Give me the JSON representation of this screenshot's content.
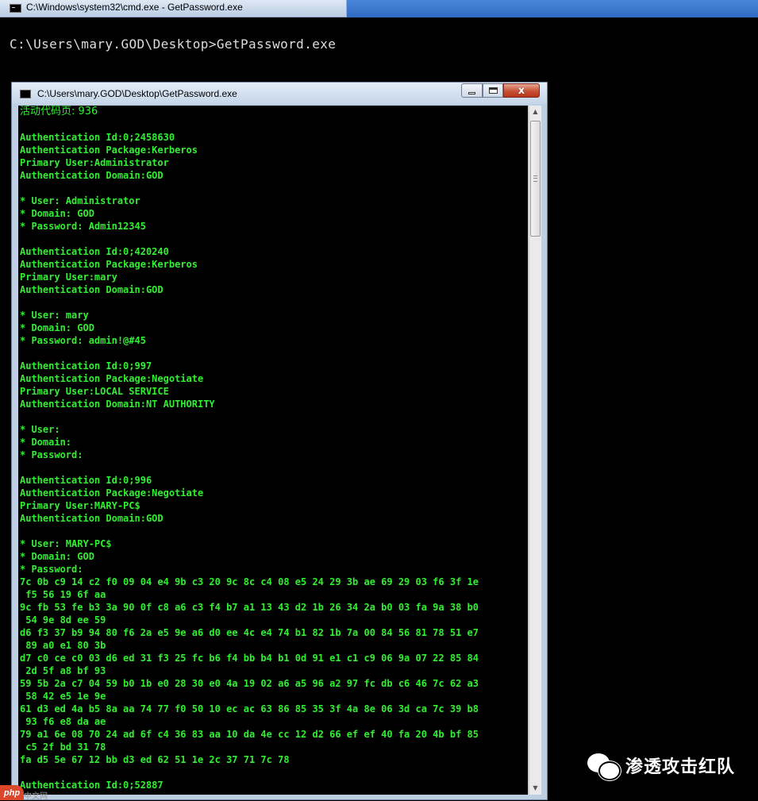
{
  "outer_window": {
    "title": "C:\\Windows\\system32\\cmd.exe - GetPassword.exe",
    "prompt_line": "C:\\Users\\mary.GOD\\Desktop>GetPassword.exe"
  },
  "inner_window": {
    "title": "C:\\Users\\mary.GOD\\Desktop\\GetPassword.exe",
    "close_glyph": "x",
    "console_lines": [
      "活动代码页: 936",
      "",
      "Authentication Id:0;2458630",
      "Authentication Package:Kerberos",
      "Primary User:Administrator",
      "Authentication Domain:GOD",
      "",
      "* User: Administrator",
      "* Domain: GOD",
      "* Password: Admin12345",
      "",
      "Authentication Id:0;420240",
      "Authentication Package:Kerberos",
      "Primary User:mary",
      "Authentication Domain:GOD",
      "",
      "* User: mary",
      "* Domain: GOD",
      "* Password: admin!@#45",
      "",
      "Authentication Id:0;997",
      "Authentication Package:Negotiate",
      "Primary User:LOCAL SERVICE",
      "Authentication Domain:NT AUTHORITY",
      "",
      "* User:",
      "* Domain:",
      "* Password:",
      "",
      "Authentication Id:0;996",
      "Authentication Package:Negotiate",
      "Primary User:MARY-PC$",
      "Authentication Domain:GOD",
      "",
      "* User: MARY-PC$",
      "* Domain: GOD",
      "* Password:",
      "7c 0b c9 14 c2 f0 09 04 e4 9b c3 20 9c 8c c4 08 e5 24 29 3b ae 69 29 03 f6 3f 1e",
      " f5 56 19 6f aa",
      "9c fb 53 fe b3 3a 90 0f c8 a6 c3 f4 b7 a1 13 43 d2 1b 26 34 2a b0 03 fa 9a 38 b0",
      " 54 9e 8d ee 59",
      "d6 f3 37 b9 94 80 f6 2a e5 9e a6 d0 ee 4c e4 74 b1 82 1b 7a 00 84 56 81 78 51 e7",
      " 89 a0 e1 80 3b",
      "d7 c0 ce c0 03 d6 ed 31 f3 25 fc b6 f4 bb b4 b1 0d 91 e1 c1 c9 06 9a 07 22 85 84",
      " 2d 5f a8 bf 93",
      "59 5b 2a c7 04 59 b0 1b e0 28 30 e0 4a 19 02 a6 a5 96 a2 97 fc db c6 46 7c 62 a3",
      " 58 42 e5 1e 9e",
      "61 d3 ed 4a b5 8a aa 74 77 f0 50 10 ec ac 63 86 85 35 3f 4a 8e 06 3d ca 7c 39 b8",
      " 93 f6 e8 da ae",
      "79 a1 6e 08 70 24 ad 6f c4 36 83 aa 10 da 4e cc 12 d2 66 ef ef 40 fa 20 4b bf 85",
      " c5 2f bd 31 78",
      "fa d5 5e 67 12 bb d3 ed 62 51 1e 2c 37 71 7c 78",
      "",
      "Authentication Id:0;52887"
    ]
  },
  "watermark": {
    "text": "渗透攻击红队",
    "icon": "wechat-icon"
  },
  "corner_badge": {
    "label": "php",
    "sub": "中文网"
  },
  "colors": {
    "console_text": "#30ef30",
    "console_bg": "#000000"
  }
}
